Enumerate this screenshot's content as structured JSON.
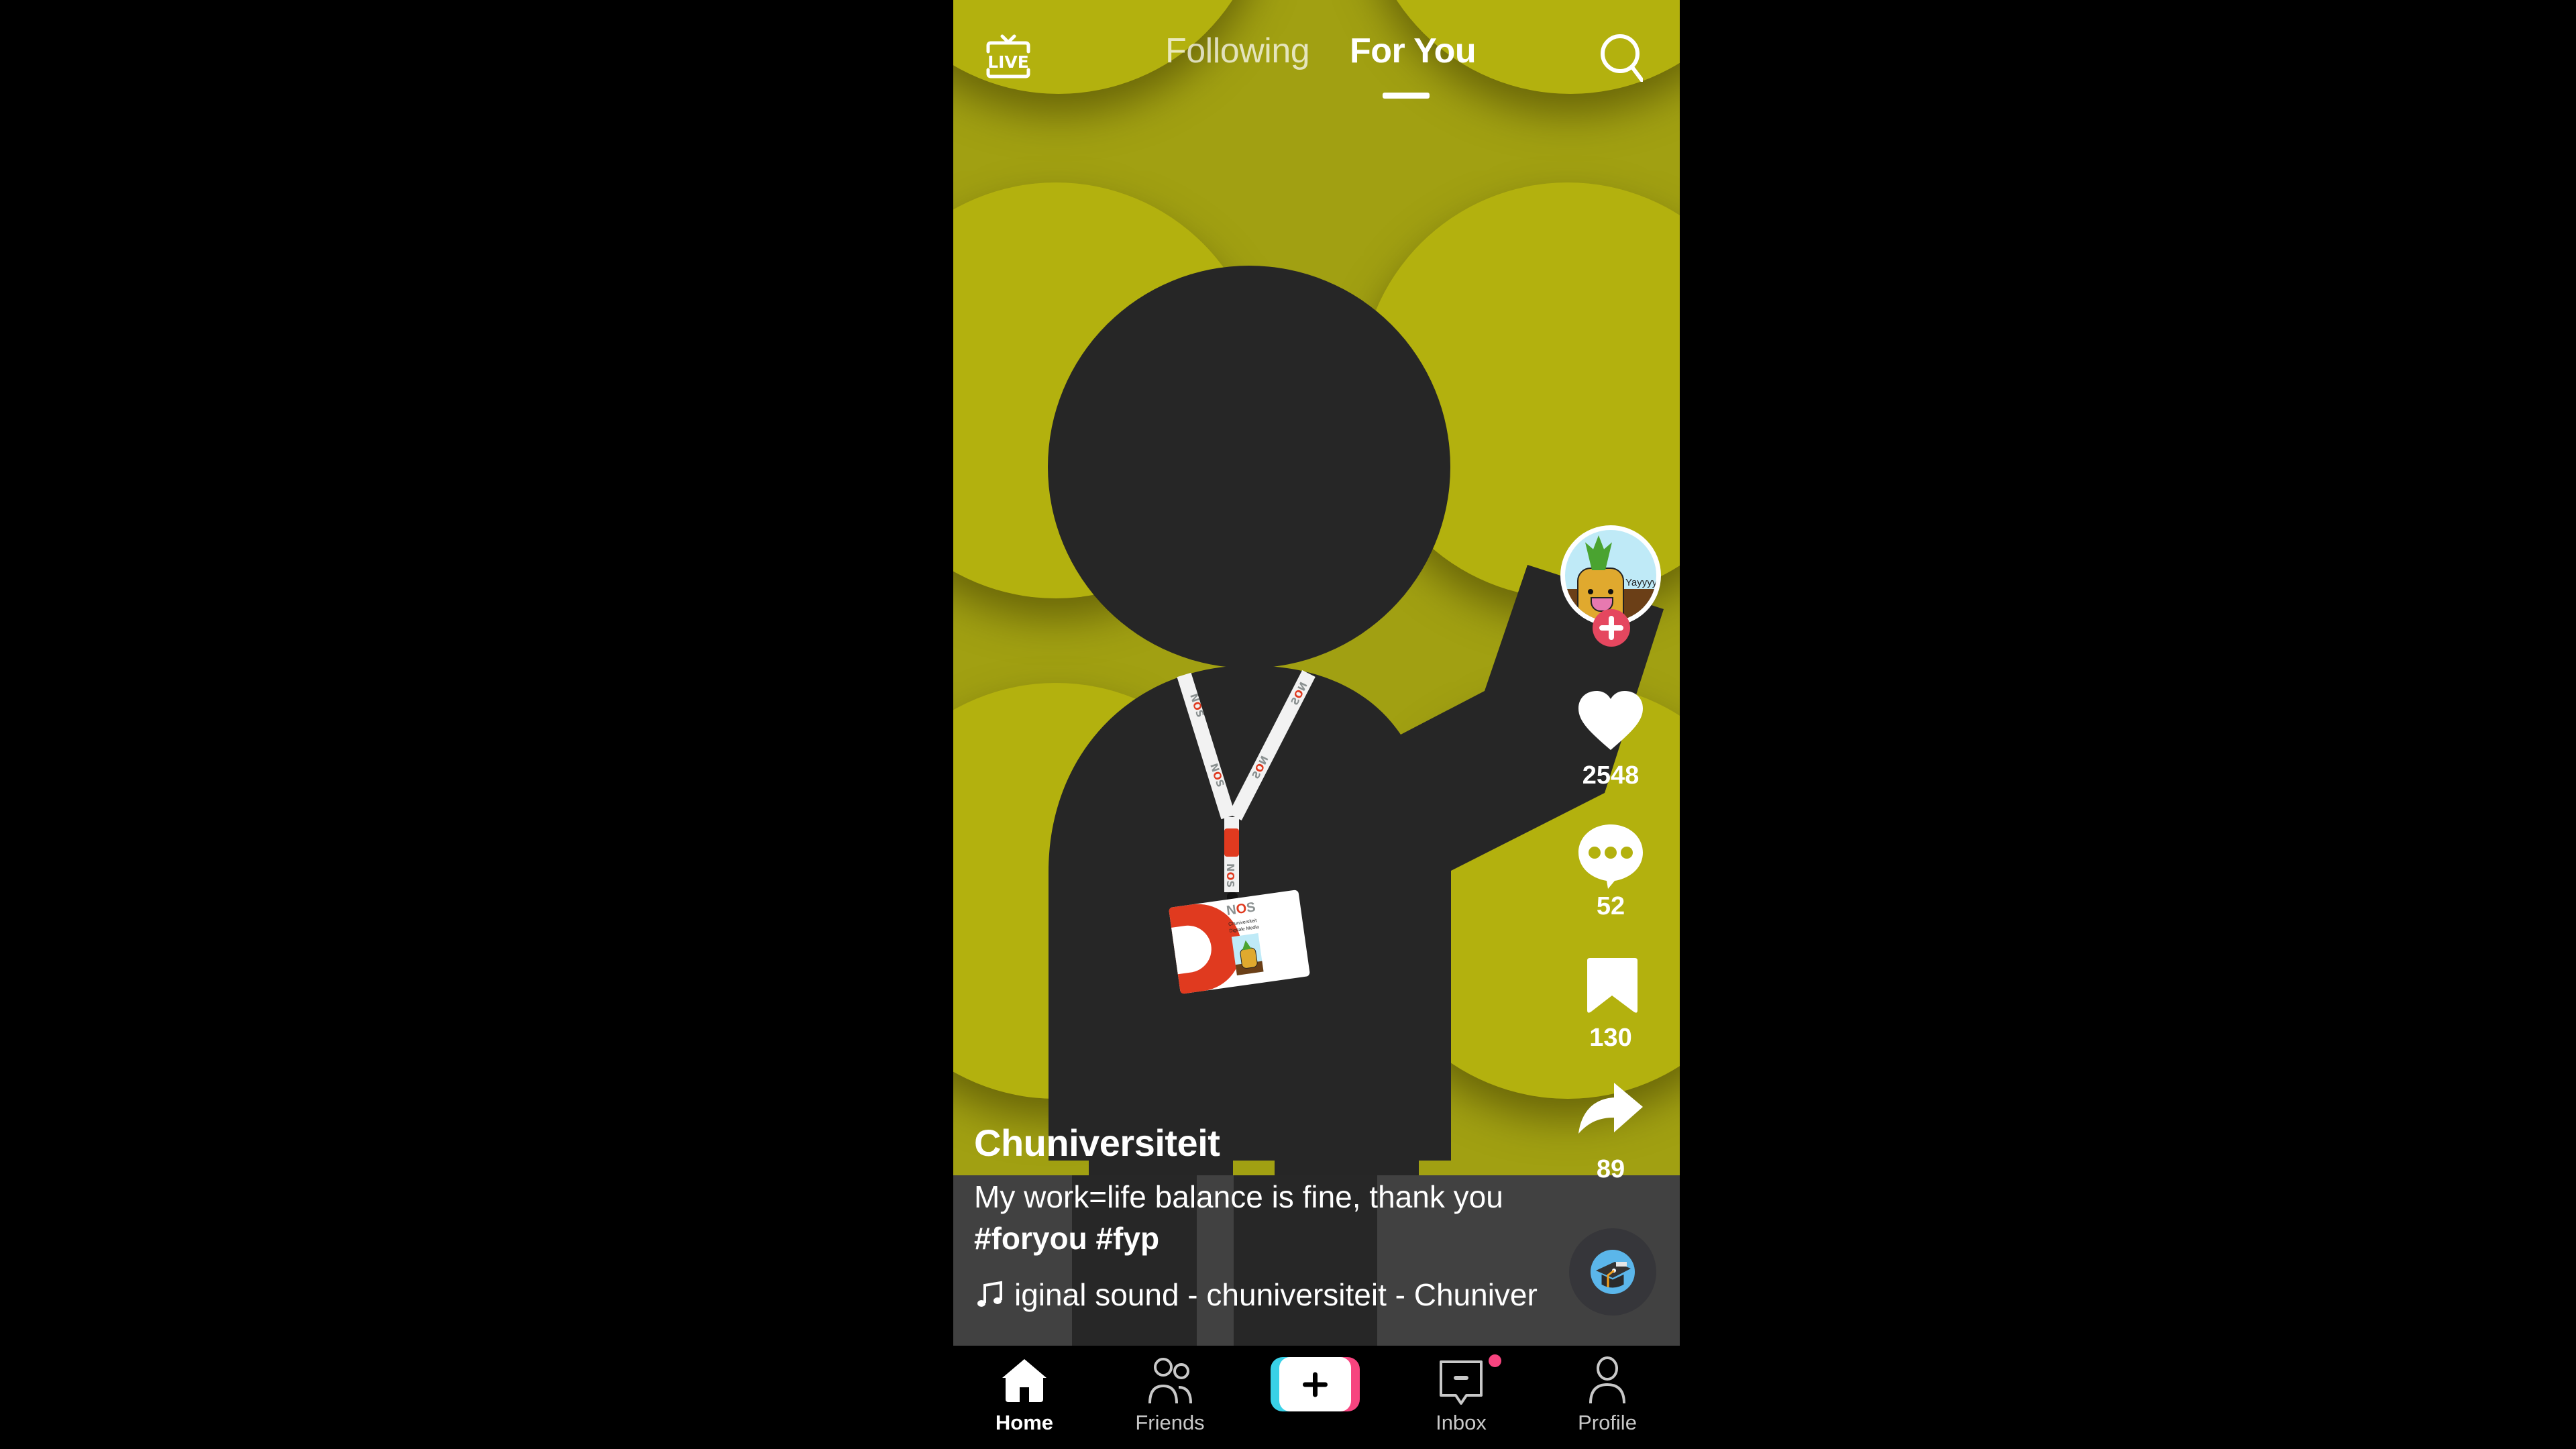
{
  "app": "TikTok",
  "top_bar": {
    "live_icon": "live-tv-icon",
    "live_label": "LIVE",
    "tabs": [
      {
        "label": "Following",
        "active": false
      },
      {
        "label": "For You",
        "active": true
      }
    ],
    "search_icon": "search-icon"
  },
  "video": {
    "background_color": "#b3b10e",
    "shade_color": "#a1a012",
    "figure_color": "#262626",
    "badge": {
      "brand": "NOS",
      "name": "Chuniversiteit",
      "department": "Digitale Media"
    },
    "avatar_caption": "Yayyyy!"
  },
  "right_rail": {
    "follow_icon": "plus-icon",
    "likes": {
      "icon": "heart-icon",
      "count": "2548"
    },
    "comments": {
      "icon": "comment-icon",
      "count": "52"
    },
    "saves": {
      "icon": "bookmark-icon",
      "count": "130"
    },
    "shares": {
      "icon": "share-icon",
      "count": "89"
    }
  },
  "post": {
    "username": "Chuniversiteit",
    "caption": "My work=life balance is fine, thank you",
    "hashtags": "#foryou #fyp",
    "music_icon": "music-note-icon",
    "music": "iginal sound - chuniversiteit - Chuniver"
  },
  "bottom_nav": {
    "items": [
      {
        "label": "Home",
        "icon": "home-icon",
        "active": true
      },
      {
        "label": "Friends",
        "icon": "friends-icon",
        "active": false
      },
      {
        "label": "",
        "icon": "create-plus-icon",
        "active": false
      },
      {
        "label": "Inbox",
        "icon": "inbox-icon",
        "active": false,
        "has_notification": true
      },
      {
        "label": "Profile",
        "icon": "profile-icon",
        "active": false
      }
    ],
    "accent_cyan": "#39d1e7",
    "accent_pink": "#f7447f",
    "notification_color": "#f7447f"
  }
}
